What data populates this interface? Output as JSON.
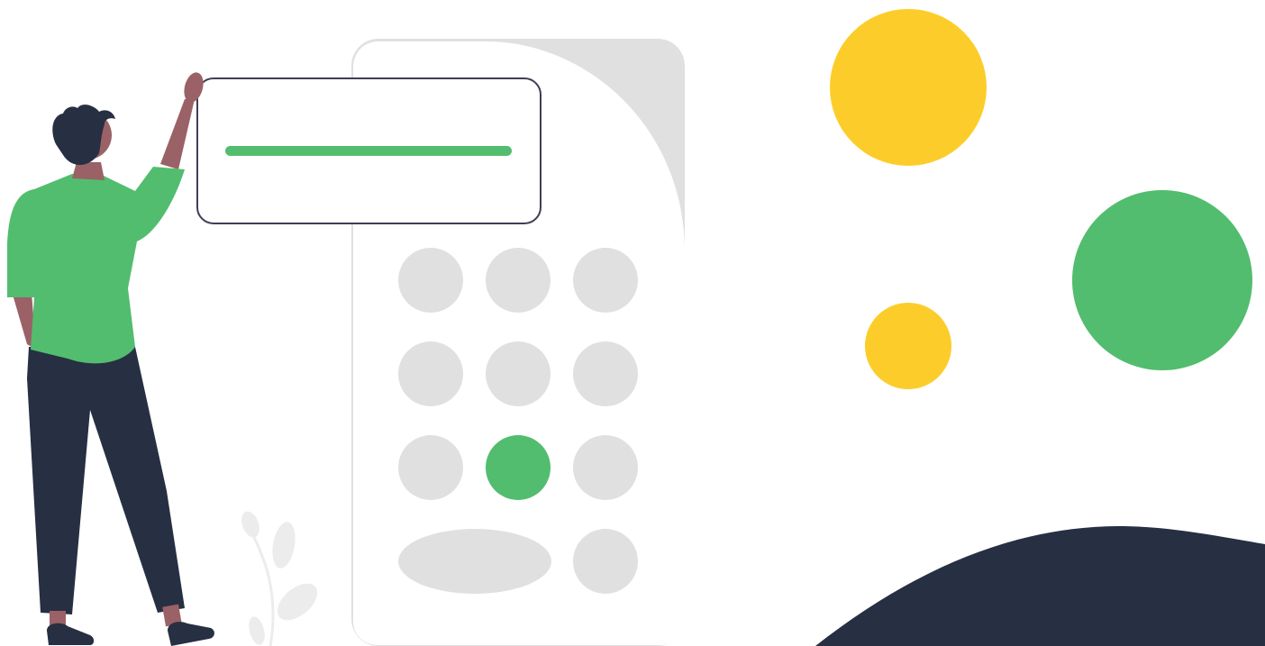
{
  "colors": {
    "background": "#ffffff",
    "keypad_body": "#e0e0e0",
    "keypad_panel": "#ffffff",
    "key_default": "#e0e0e0",
    "key_active": "#52bd6e",
    "display_bar": "#52bd6e",
    "display_border": "#3f3d56",
    "yellow": "#fccd2a",
    "green": "#52bd6e",
    "navy": "#272f42",
    "skin": "#9a6266",
    "shirt": "#52bd6e",
    "pants": "#272f42",
    "hair": "#272f42",
    "plant": "#ececec"
  },
  "keypad": {
    "active_key": "key-row3-col2",
    "key_rows": 4,
    "key_cols": 3
  },
  "display": {
    "input_fill": 1.0
  },
  "icons": {
    "person": "person-pressing-keypad-illustration",
    "plant": "leafy-plant-illustration"
  }
}
